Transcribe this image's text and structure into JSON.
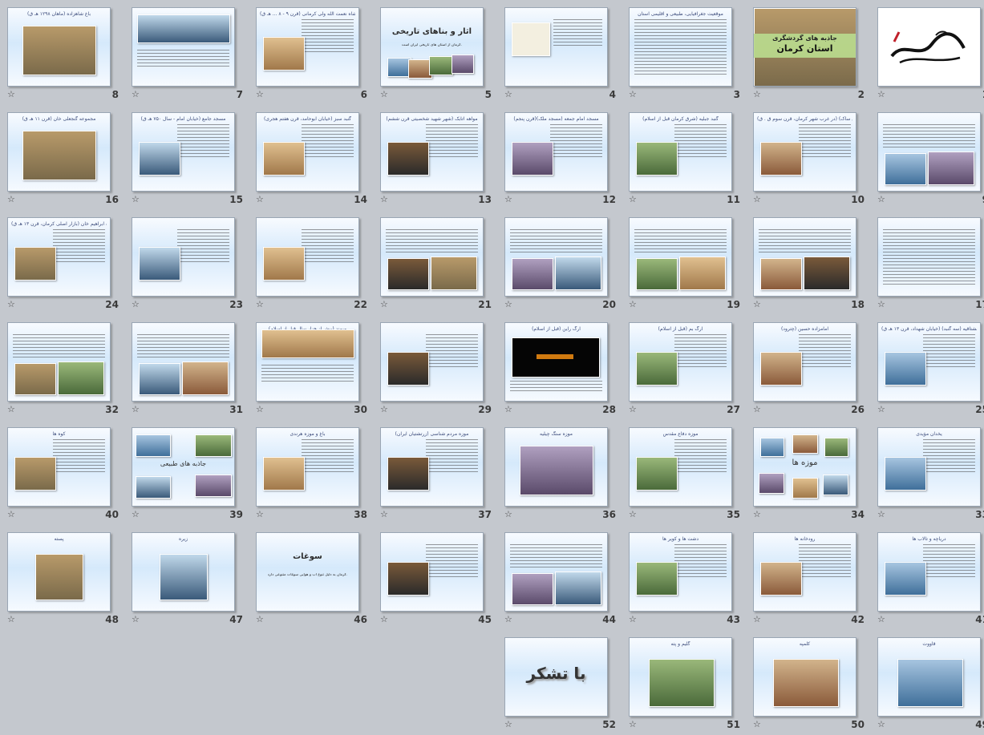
{
  "star_glyph": "☆",
  "slides": [
    {
      "n": "1",
      "title": "",
      "kind": "logo"
    },
    {
      "n": "2",
      "title": "جاذبه های گردشگری",
      "subtitle": "استان کرمان",
      "kind": "cover"
    },
    {
      "n": "3",
      "title": "موقعیت جغرافیایی، طبیعی و اقلیمی استان",
      "kind": "text"
    },
    {
      "n": "4",
      "title": "",
      "kind": "map"
    },
    {
      "n": "5",
      "title": "آثار و بناهای تاریخی",
      "kind": "section"
    },
    {
      "n": "6",
      "title": "مزار شاه نعمت الله ولی کرمانی (قرن ۹ - ۸ ... هـ ق)",
      "kind": "text-img"
    },
    {
      "n": "7",
      "title": "",
      "kind": "img-text"
    },
    {
      "n": "8",
      "title": "باغ شاهزاده (ماهان ۱۲۹۸ هـ ق)",
      "kind": "img"
    },
    {
      "n": "9",
      "title": "",
      "kind": "text-img2"
    },
    {
      "n": "10",
      "title": "تخت دراگ (تل ساک) (در غرب شهر کرمان، قرن سوم ق . ق)",
      "kind": "text-img"
    },
    {
      "n": "11",
      "title": "گنبد جبلیه (شرق کرمان قبل از اسلام)",
      "kind": "text-img"
    },
    {
      "n": "12",
      "title": "مسجد امام جمعه (مسجد ملک)(قرن پنجم)",
      "kind": "text-img"
    },
    {
      "n": "13",
      "title": "مواهه اتابک (شهر شهید شخصیتی قرن ششم)",
      "kind": "text-img"
    },
    {
      "n": "14",
      "title": "گنبد سبز (خیابان ابوحامد، قرن هفتم هجری)",
      "kind": "text-img"
    },
    {
      "n": "15",
      "title": "مسجد جامع (خیابان امام - سال ۷۵۰ هـ ق)",
      "kind": "text-img"
    },
    {
      "n": "16",
      "title": "مجموعه گنجعلی خان (قرن ۱۱ هـ ق)",
      "kind": "img"
    },
    {
      "n": "17",
      "title": "",
      "kind": "text"
    },
    {
      "n": "18",
      "title": "",
      "kind": "text-img2"
    },
    {
      "n": "19",
      "title": "",
      "kind": "text-img2"
    },
    {
      "n": "20",
      "title": "",
      "kind": "text-img2"
    },
    {
      "n": "21",
      "title": "",
      "kind": "text-img2"
    },
    {
      "n": "22",
      "title": "",
      "kind": "text-img"
    },
    {
      "n": "23",
      "title": "",
      "kind": "text-img"
    },
    {
      "n": "24",
      "title": "مجموعه ابراهیم خان (بازار اصلی کرمان، قرن ۱۳ هـ ق)",
      "kind": "text-img"
    },
    {
      "n": "25",
      "title": "مشتاقیه (سه گنبد) (خیابان شهداد، قرن ۱۳ هـ ق)",
      "kind": "text-img"
    },
    {
      "n": "26",
      "title": "امامزاده حسین (چترود)",
      "kind": "text-img"
    },
    {
      "n": "27",
      "title": "ارگ بم (قبل از اسلام)",
      "kind": "text-img"
    },
    {
      "n": "28",
      "title": "ارگ راین (قبل از اسلام)",
      "kind": "dark-img"
    },
    {
      "n": "29",
      "title": "",
      "kind": "text-img"
    },
    {
      "n": "30",
      "title": "میمند (پیش از هزار سال قبل از اسلام)",
      "kind": "img-text"
    },
    {
      "n": "31",
      "title": "",
      "kind": "text-img2"
    },
    {
      "n": "32",
      "title": "",
      "kind": "text-img2"
    },
    {
      "n": "33",
      "title": "یخدان مؤیدی",
      "kind": "text-img"
    },
    {
      "n": "34",
      "title": "موزه ها",
      "kind": "collage"
    },
    {
      "n": "35",
      "title": "موزه دفاع مقدس",
      "kind": "text-img"
    },
    {
      "n": "36",
      "title": "موزه سنگ چیلیه",
      "kind": "img"
    },
    {
      "n": "37",
      "title": "موزه مردم شناسی (زرتشتیان ایران)",
      "kind": "text-img"
    },
    {
      "n": "38",
      "title": "باغ و موزه هرندی",
      "kind": "text-img"
    },
    {
      "n": "39",
      "title": "جاذبه های طبیعی",
      "kind": "collage2"
    },
    {
      "n": "40",
      "title": "کوه ها",
      "kind": "text-img"
    },
    {
      "n": "41",
      "title": "دریاچه و تالاب ها",
      "kind": "text-img"
    },
    {
      "n": "42",
      "title": "رودخانه ها",
      "kind": "text-img"
    },
    {
      "n": "43",
      "title": "دشت ها و کویر ها",
      "kind": "text-img"
    },
    {
      "n": "44",
      "title": "",
      "kind": "text-img2"
    },
    {
      "n": "45",
      "title": "",
      "kind": "text-img"
    },
    {
      "n": "46",
      "title": "سوغات",
      "kind": "section2"
    },
    {
      "n": "47",
      "title": "زیره",
      "kind": "img"
    },
    {
      "n": "48",
      "title": "پسته",
      "kind": "img"
    },
    {
      "n": "49",
      "title": "قاووت",
      "kind": "img"
    },
    {
      "n": "50",
      "title": "کلمپه",
      "kind": "img"
    },
    {
      "n": "51",
      "title": "گلیم و پته",
      "kind": "img"
    },
    {
      "n": "52",
      "title": "با تشکر",
      "kind": "thanks"
    }
  ],
  "section46_body": "کرمان به دلیل تنوع آب و هوایی سوغات متنوعی دارد.",
  "section5_body": "کرمان از استان های تاریخی ایران است."
}
